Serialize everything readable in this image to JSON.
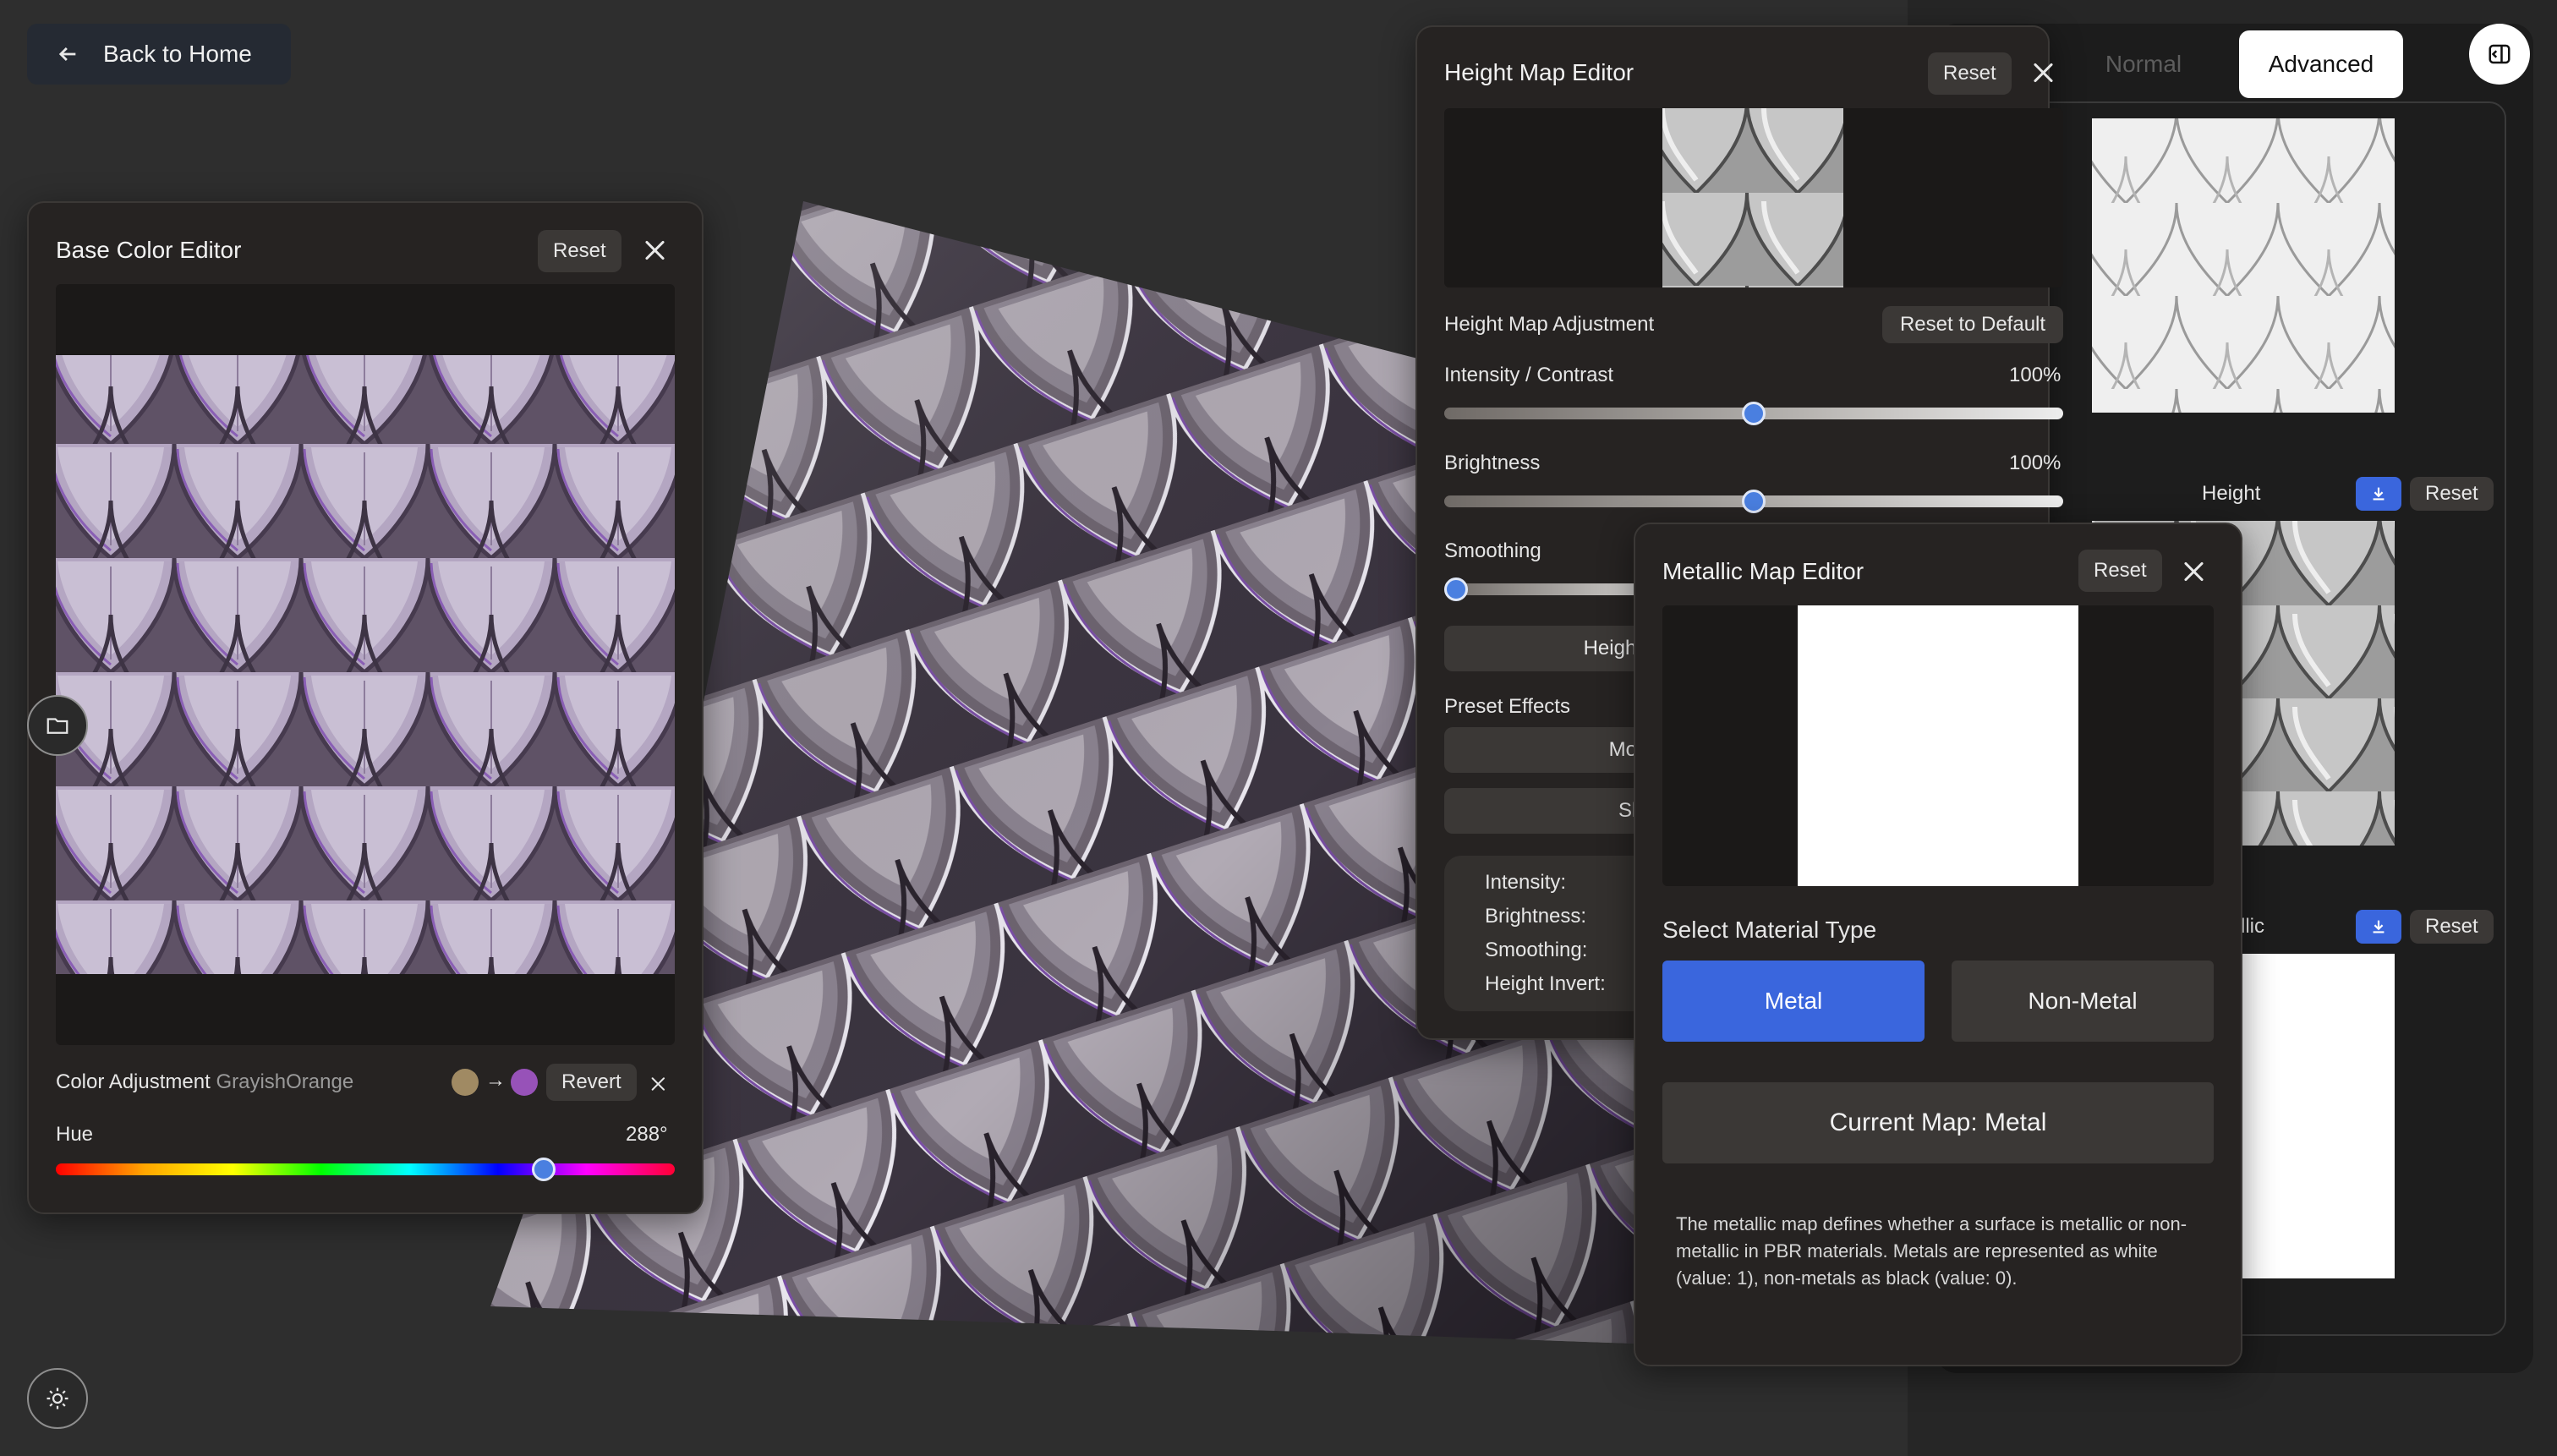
{
  "header": {
    "back_label": "Back to Home"
  },
  "view_tabs": {
    "normal": "Normal",
    "advanced": "Advanced"
  },
  "map_list": {
    "height_label": "Height",
    "metallic_label": "llic",
    "reset_label": "Reset"
  },
  "base_color_editor": {
    "title": "Base Color Editor",
    "reset_label": "Reset",
    "color_adjustment_label": "Color Adjustment",
    "color_name": "GrayishOrange",
    "from_color": "#a08a63",
    "to_color": "#9752b8",
    "arrow": "→",
    "revert_label": "Revert",
    "hue_label": "Hue",
    "hue_value": "288°",
    "hue_fraction": 0.8
  },
  "height_map_editor": {
    "title": "Height Map Editor",
    "reset_label": "Reset",
    "adjustment_label": "Height Map Adjustment",
    "reset_default_label": "Reset to Default",
    "intensity_label": "Intensity / Contrast",
    "intensity_value": "100%",
    "intensity_fraction": 0.5,
    "brightness_label": "Brightness",
    "brightness_value": "100%",
    "brightness_fraction": 0.5,
    "smoothing_label": "Smoothing",
    "smoothing_fraction": 0.0,
    "height_invert_label": "Height Inve",
    "preset_effects_label": "Preset Effects",
    "preset_mountain": "Mountair",
    "preset_sharp": "Sharp",
    "summary": {
      "intensity": "Intensity:",
      "brightness": "Brightness:",
      "smoothing": "Smoothing:",
      "height_invert": "Height Invert:"
    }
  },
  "metallic_map_editor": {
    "title": "Metallic Map Editor",
    "reset_label": "Reset",
    "select_type_label": "Select Material Type",
    "metal_label": "Metal",
    "non_metal_label": "Non-Metal",
    "current_map_label": "Current Map: Metal",
    "description": "The metallic map defines whether a surface is metallic or non-metallic in PBR materials. Metals are represented as white (value: 1), non-metals as black (value: 0)."
  },
  "colors": {
    "accent": "#3a66dd",
    "background": "#2e2e2e",
    "panel": "#262322"
  },
  "icons": {
    "back": "arrow-left-icon",
    "close": "close-icon",
    "folder": "folder-icon",
    "brightness": "sun-icon",
    "download": "download-icon",
    "sidebar_toggle": "sidebar-toggle-icon"
  }
}
